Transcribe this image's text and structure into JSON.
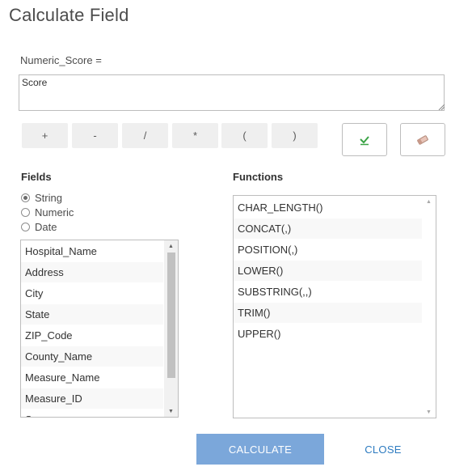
{
  "dialog": {
    "title": "Calculate Field"
  },
  "expression": {
    "label": "Numeric_Score =",
    "value": "Score"
  },
  "operators": [
    "+",
    "-",
    "/",
    "*",
    "(",
    ")"
  ],
  "tools": {
    "validate_icon": "check-icon",
    "clear_icon": "eraser-icon"
  },
  "fields": {
    "heading": "Fields",
    "filters": [
      {
        "label": "String",
        "selected": true
      },
      {
        "label": "Numeric",
        "selected": false
      },
      {
        "label": "Date",
        "selected": false
      }
    ],
    "items": [
      "Hospital_Name",
      "Address",
      "City",
      "State",
      "ZIP_Code",
      "County_Name",
      "Measure_Name",
      "Measure_ID",
      "S"
    ]
  },
  "functions": {
    "heading": "Functions",
    "items": [
      "CHAR_LENGTH()",
      "CONCAT(,)",
      "POSITION(,)",
      "LOWER()",
      "SUBSTRING(,,)",
      "TRIM()",
      "UPPER()"
    ]
  },
  "actions": {
    "calculate": "CALCULATE",
    "close": "CLOSE"
  },
  "colors": {
    "accent": "#7ba7da",
    "link": "#2d7bc0",
    "check": "#3aa345"
  }
}
